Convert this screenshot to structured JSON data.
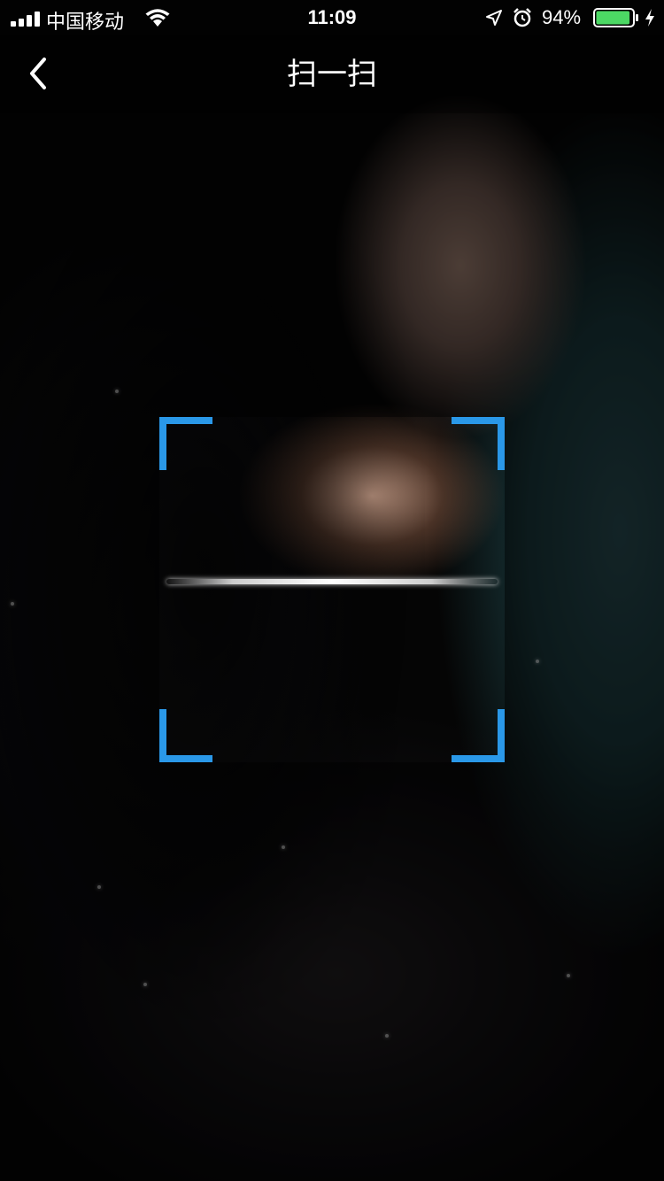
{
  "status_bar": {
    "carrier": "中国移动",
    "time": "11:09",
    "battery_percent": "94%",
    "battery_level": 0.94,
    "icons": [
      "signal-icon",
      "wifi-icon",
      "location-icon",
      "alarm-icon",
      "battery-icon",
      "charging-icon"
    ]
  },
  "nav": {
    "title": "扫一扫",
    "back_icon": "chevron-left-icon"
  },
  "scanner": {
    "frame_color": "#2a98e8",
    "scan_line_color": "#ffffff"
  },
  "colors": {
    "accent": "#2a98e8",
    "battery_fill": "#4cd964"
  }
}
